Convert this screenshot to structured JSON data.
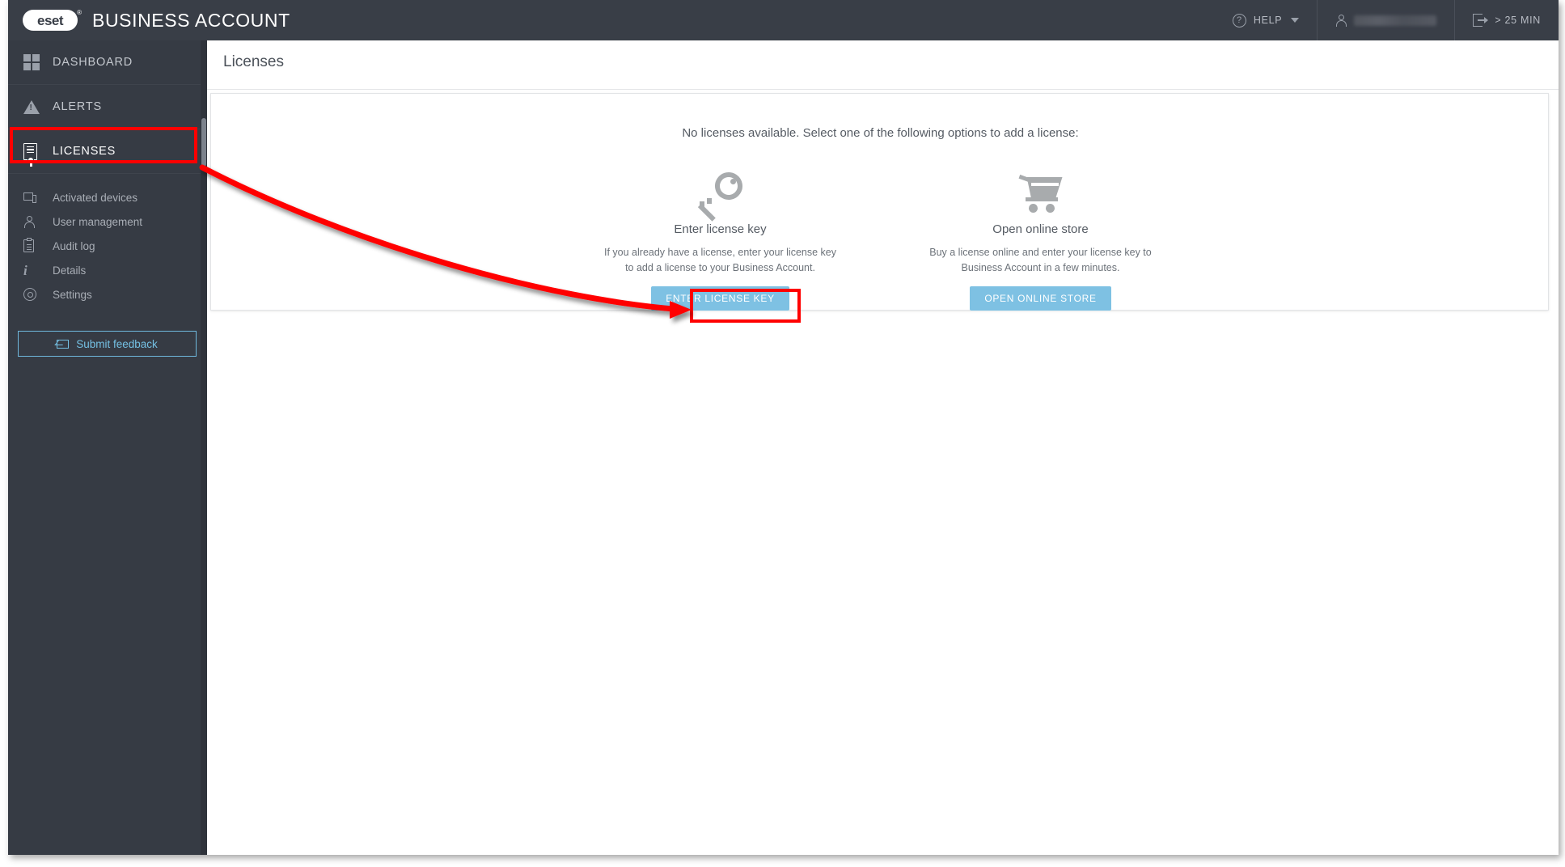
{
  "header": {
    "logo_text": "eset",
    "logo_registered": "®",
    "app_title": "BUSINESS ACCOUNT",
    "help_label": "HELP",
    "help_icon": "question-circle-icon",
    "help_caret_icon": "chevron-down-icon",
    "user_icon": "person-icon",
    "user_name": "",
    "session_icon": "logout-icon",
    "session_timer": "> 25 MIN"
  },
  "sidebar": {
    "primary_items": [
      {
        "label": "DASHBOARD",
        "icon": "grid-icon",
        "active": false
      },
      {
        "label": "ALERTS",
        "icon": "warning-triangle-icon",
        "active": false
      },
      {
        "label": "LICENSES",
        "icon": "certificate-icon",
        "active": true
      }
    ],
    "secondary_items": [
      {
        "label": "Activated devices",
        "icon": "devices-icon"
      },
      {
        "label": "User management",
        "icon": "person-icon"
      },
      {
        "label": "Audit log",
        "icon": "clipboard-icon"
      },
      {
        "label": "Details",
        "icon": "info-icon"
      },
      {
        "label": "Settings",
        "icon": "gear-icon"
      }
    ],
    "feedback": {
      "label": "Submit feedback",
      "icon": "envelope-icon"
    }
  },
  "main": {
    "page_title": "Licenses",
    "empty_message": "No licenses available. Select one of the following options to add a license:",
    "options": [
      {
        "icon": "key-icon",
        "heading": "Enter license key",
        "description": "If you already have a license, enter your license key to add a license to your Business Account.",
        "button_label": "ENTER LICENSE KEY"
      },
      {
        "icon": "shopping-cart-icon",
        "heading": "Open online store",
        "description": "Buy a license online and enter your license key to Business Account in a few minutes.",
        "button_label": "OPEN ONLINE STORE"
      }
    ]
  },
  "annotations": {
    "highlight_color": "#ff0000",
    "boxes": [
      "sidebar-item-licenses",
      "enter-license-key-button"
    ],
    "arrow": "curved arrow from LICENSES sidebar item to ENTER LICENSE KEY button"
  },
  "colors": {
    "header_bg": "#393e47",
    "sidebar_bg": "#363b44",
    "accent_button": "#7ec1e3",
    "feedback_accent": "#74c0e3",
    "annotation_red": "#ff0000"
  }
}
